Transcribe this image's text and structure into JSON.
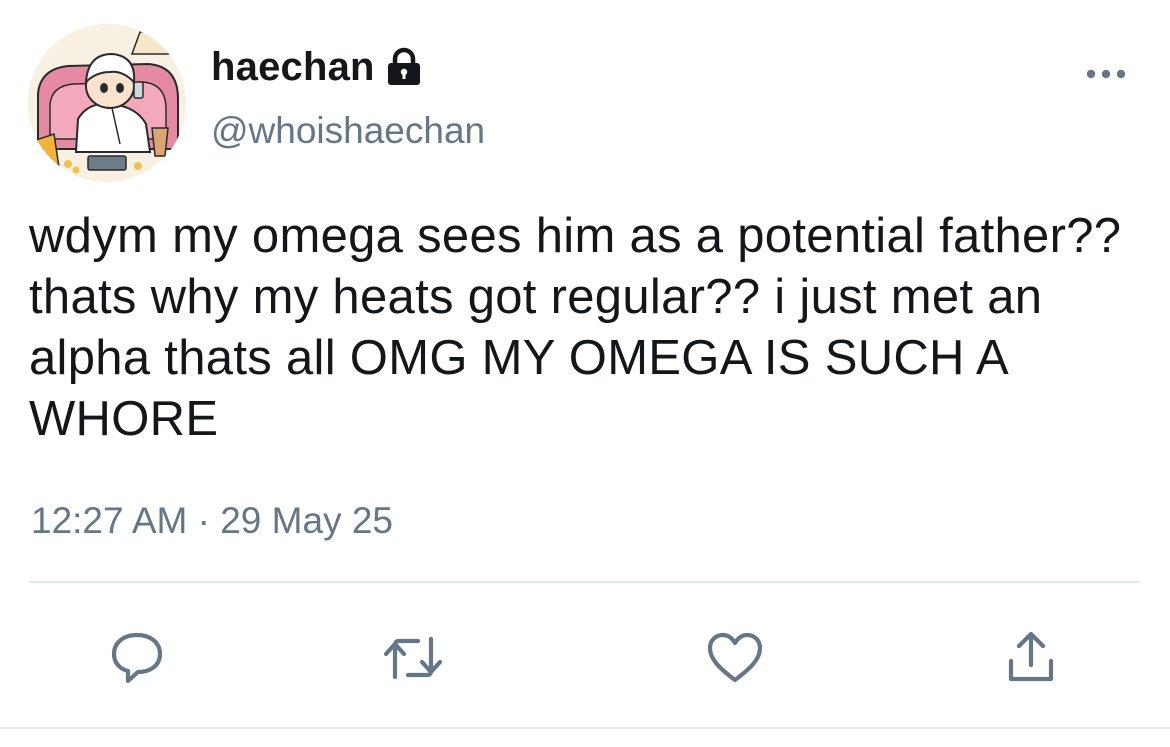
{
  "author": {
    "display_name": "haechan",
    "handle": "@whoishaechan",
    "protected": true
  },
  "tweet": {
    "text": "wdym my omega sees him as a potential father?? thats why my heats got regular?? i just met an alpha thats all OMG MY OMEGA IS SUCH A WHORE",
    "time": "12:27 AM",
    "separator": "·",
    "date": "29 May 25"
  },
  "actions": [
    {
      "icon": "reply-icon"
    },
    {
      "icon": "retweet-icon"
    },
    {
      "icon": "like-icon"
    },
    {
      "icon": "share-icon"
    }
  ],
  "colors": {
    "primary_text": "#14171a",
    "secondary_text": "#657786",
    "divider": "#e1e8ed",
    "icon": "#657786"
  }
}
